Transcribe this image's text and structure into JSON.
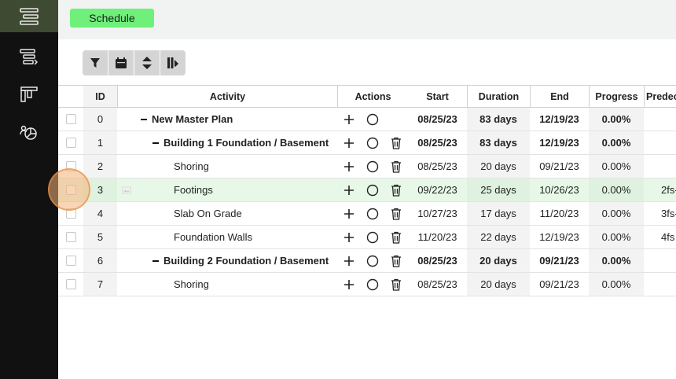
{
  "sidebar": {
    "items": [
      {
        "icon": "gantt-icon",
        "active": true
      },
      {
        "icon": "task-list-icon",
        "active": false
      },
      {
        "icon": "board-icon",
        "active": false
      },
      {
        "icon": "resources-icon",
        "active": false
      }
    ]
  },
  "header": {
    "schedule_label": "Schedule",
    "accent": "#6ef07a"
  },
  "toolbar": {
    "buttons": [
      "filter-icon",
      "calendar-icon",
      "sort-icon",
      "columns-icon"
    ]
  },
  "table": {
    "columns": {
      "id": "ID",
      "activity": "Activity",
      "actions": "Actions",
      "start": "Start",
      "duration": "Duration",
      "end": "End",
      "progress": "Progress",
      "predecessors": "Predec"
    },
    "rows": [
      {
        "id": "0",
        "activity": "New Master Plan",
        "start": "08/25/23",
        "duration": "83 days",
        "end": "12/19/23",
        "progress": "0.00%",
        "predecessors": ""
      },
      {
        "id": "1",
        "activity": "Building 1 Foundation / Basement",
        "start": "08/25/23",
        "duration": "83 days",
        "end": "12/19/23",
        "progress": "0.00%",
        "predecessors": ""
      },
      {
        "id": "2",
        "activity": "Shoring",
        "start": "08/25/23",
        "duration": "20 days",
        "end": "09/21/23",
        "progress": "0.00%",
        "predecessors": ""
      },
      {
        "id": "3",
        "activity": "Footings",
        "start": "09/22/23",
        "duration": "25 days",
        "end": "10/26/23",
        "progress": "0.00%",
        "predecessors": "2fs-"
      },
      {
        "id": "4",
        "activity": "Slab On Grade",
        "start": "10/27/23",
        "duration": "17 days",
        "end": "11/20/23",
        "progress": "0.00%",
        "predecessors": "3fs-"
      },
      {
        "id": "5",
        "activity": "Foundation Walls",
        "start": "11/20/23",
        "duration": "22 days",
        "end": "12/19/23",
        "progress": "0.00%",
        "predecessors": "4fs"
      },
      {
        "id": "6",
        "activity": "Building 2 Foundation / Basement",
        "start": "08/25/23",
        "duration": "20 days",
        "end": "09/21/23",
        "progress": "0.00%",
        "predecessors": ""
      },
      {
        "id": "7",
        "activity": "Shoring",
        "start": "08/25/23",
        "duration": "20 days",
        "end": "09/21/23",
        "progress": "0.00%",
        "predecessors": ""
      }
    ]
  }
}
